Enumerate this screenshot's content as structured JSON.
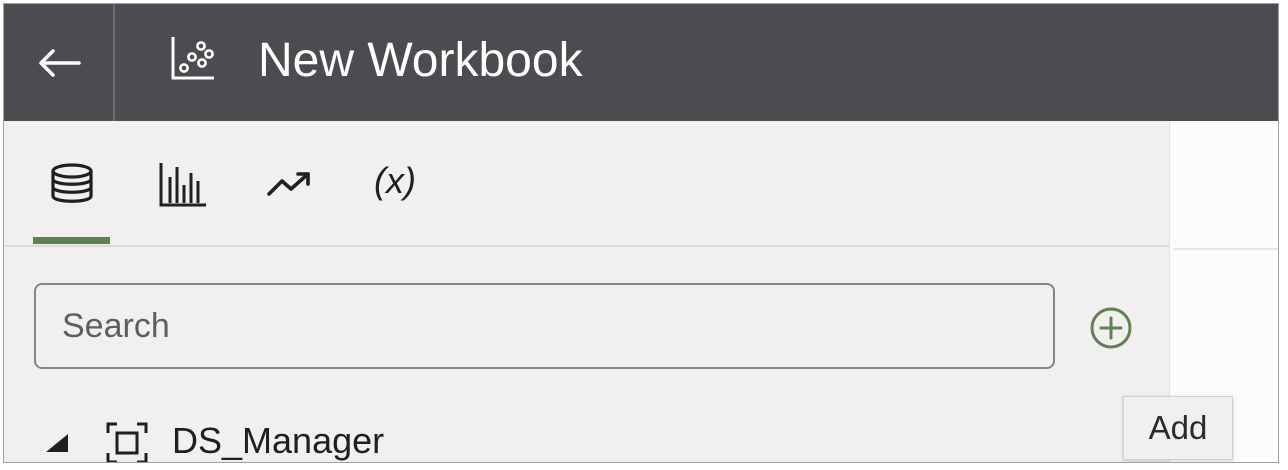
{
  "header": {
    "back_icon": "arrow-left-icon",
    "workbook_icon": "scatter-chart-icon",
    "title": "New Workbook"
  },
  "tabs": [
    {
      "icon": "database-icon",
      "label": "",
      "active": true
    },
    {
      "icon": "bar-chart-icon",
      "label": "",
      "active": false
    },
    {
      "icon": "trend-icon",
      "label": "",
      "active": false
    },
    {
      "icon": "calculation-icon",
      "label": "(x)",
      "active": false
    }
  ],
  "search": {
    "placeholder": "Search",
    "value": ""
  },
  "add_button": {
    "icon": "plus-circle-icon",
    "tooltip": "Add"
  },
  "tree": [
    {
      "label": "DS_Manager",
      "icon": "dataset-icon",
      "expanded": true
    }
  ],
  "colors": {
    "header_bg": "#4a4c50",
    "panel_bg": "#f1f0ee",
    "accent": "#5f7f55"
  }
}
